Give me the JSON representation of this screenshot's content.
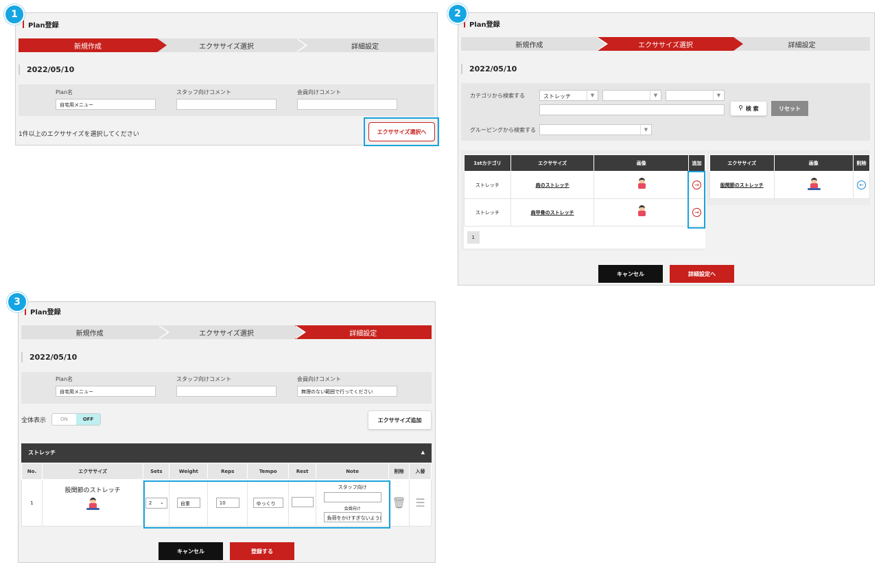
{
  "steps": [
    "1",
    "2",
    "3"
  ],
  "common": {
    "title": "Plan登録",
    "date": "2022/05/10",
    "stepper": [
      "新規作成",
      "エクササイズ選択",
      "詳細設定"
    ],
    "labels": {
      "plan_name": "Plan名",
      "staff_comment": "スタッフ向けコメント",
      "member_comment": "会員向けコメント"
    },
    "plan_name_value": "自宅用メニュー"
  },
  "panel1": {
    "hint": "1件以上のエクササイズを選択してください",
    "next_button": "エクササイズ選択へ"
  },
  "panel2": {
    "category_label": "カテゴリから検索する",
    "category_value": "ストレッチ",
    "search_button": "検 索",
    "reset_button": "リセット",
    "grouping_label": "グルーピングから検索する",
    "left_table": {
      "headers": [
        "1stカテゴリ",
        "エクササイズ",
        "画像",
        "追加"
      ],
      "rows": [
        {
          "category": "ストレッチ",
          "exercise": "肩のストレッチ"
        },
        {
          "category": "ストレッチ",
          "exercise": "肩甲骨のストレッチ"
        }
      ],
      "page": "1"
    },
    "right_table": {
      "headers": [
        "エクササイズ",
        "画像",
        "削除"
      ],
      "rows": [
        {
          "exercise": "股関節のストレッチ"
        }
      ]
    },
    "cancel_button": "キャンセル",
    "next_button": "詳細設定へ"
  },
  "panel3": {
    "member_comment_value": "無理のない範囲で行ってください",
    "show_all_label": "全体表示",
    "toggle_on": "ON",
    "toggle_off": "OFF",
    "add_exercise_button": "エクササイズ追加",
    "section_title": "ストレッチ",
    "section_caret": "▲",
    "headers": [
      "No.",
      "エクササイズ",
      "Sets",
      "Weight",
      "Reps",
      "Tempo",
      "Rest",
      "Note",
      "削除",
      "入替"
    ],
    "row": {
      "no": "1",
      "exercise": "股関節のストレッチ",
      "sets": "2",
      "weight": "自重",
      "reps": "10",
      "tempo": "ゆっくり",
      "rest": "",
      "note_staff_label": "スタッフ向け",
      "note_member_label": "会員向け",
      "note_member_value": "負荷をかけすぎないように"
    },
    "cancel_button": "キャンセル",
    "register_button": "登録する"
  }
}
